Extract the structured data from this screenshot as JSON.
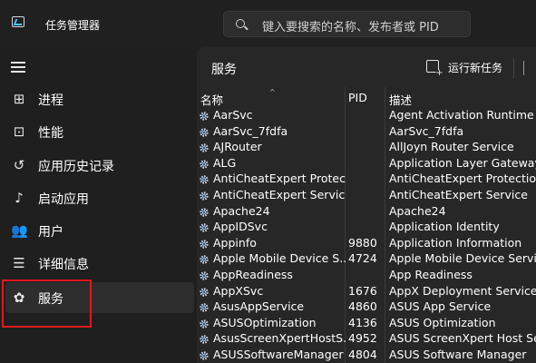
{
  "app": {
    "title": "任务管理器",
    "icon": "task-manager-icon"
  },
  "search": {
    "placeholder": "键入要搜索的名称、发布者或 PID"
  },
  "sidebar": {
    "items": [
      {
        "label": "进程",
        "icon": "processes-icon",
        "glyph": "⊞"
      },
      {
        "label": "性能",
        "icon": "performance-icon",
        "glyph": "⊡"
      },
      {
        "label": "应用历史记录",
        "icon": "history-icon",
        "glyph": "↺"
      },
      {
        "label": "启动应用",
        "icon": "startup-icon",
        "glyph": "♪"
      },
      {
        "label": "用户",
        "icon": "users-icon",
        "glyph": "👥"
      },
      {
        "label": "详细信息",
        "icon": "details-icon",
        "glyph": "☰"
      },
      {
        "label": "服务",
        "icon": "services-icon",
        "glyph": "✿",
        "active": true
      }
    ]
  },
  "main": {
    "title": "服务",
    "run_task_label": "运行新任务",
    "columns": {
      "name": "名称",
      "pid": "PID",
      "desc": "描述"
    },
    "rows": [
      {
        "name": "AarSvc",
        "pid": "",
        "desc": "Agent Activation Runtime"
      },
      {
        "name": "AarSvc_7fdfa",
        "pid": "",
        "desc": "AarSvc_7fdfa"
      },
      {
        "name": "AJRouter",
        "pid": "",
        "desc": "AllJoyn Router Service"
      },
      {
        "name": "ALG",
        "pid": "",
        "desc": "Application Layer Gateway Serv"
      },
      {
        "name": "AntiCheatExpert Protec...",
        "pid": "",
        "desc": "AntiCheatExpert Protection"
      },
      {
        "name": "AntiCheatExpert Service",
        "pid": "",
        "desc": "AntiCheatExpert Service"
      },
      {
        "name": "Apache24",
        "pid": "",
        "desc": "Apache24"
      },
      {
        "name": "AppIDSvc",
        "pid": "",
        "desc": "Application Identity"
      },
      {
        "name": "Appinfo",
        "pid": "9880",
        "desc": "Application Information"
      },
      {
        "name": "Apple Mobile Device S...",
        "pid": "4724",
        "desc": "Apple Mobile Device Service"
      },
      {
        "name": "AppReadiness",
        "pid": "",
        "desc": "App Readiness"
      },
      {
        "name": "AppXSvc",
        "pid": "1676",
        "desc": "AppX Deployment Service (Ap"
      },
      {
        "name": "AsusAppService",
        "pid": "4860",
        "desc": "ASUS App Service"
      },
      {
        "name": "ASUSOptimization",
        "pid": "4136",
        "desc": "ASUS Optimization"
      },
      {
        "name": "AsusScreenXpertHostS...",
        "pid": "4952",
        "desc": "ASUS ScreenXpert Host Serv"
      },
      {
        "name": "ASUSSoftwareManager",
        "pid": "4804",
        "desc": "ASUS Software Manager"
      }
    ]
  },
  "colors": {
    "background": "#1f1f1f",
    "panel": "#272727",
    "highlight_border": "#e0191e",
    "gear_accent": "#8fb3e0"
  }
}
